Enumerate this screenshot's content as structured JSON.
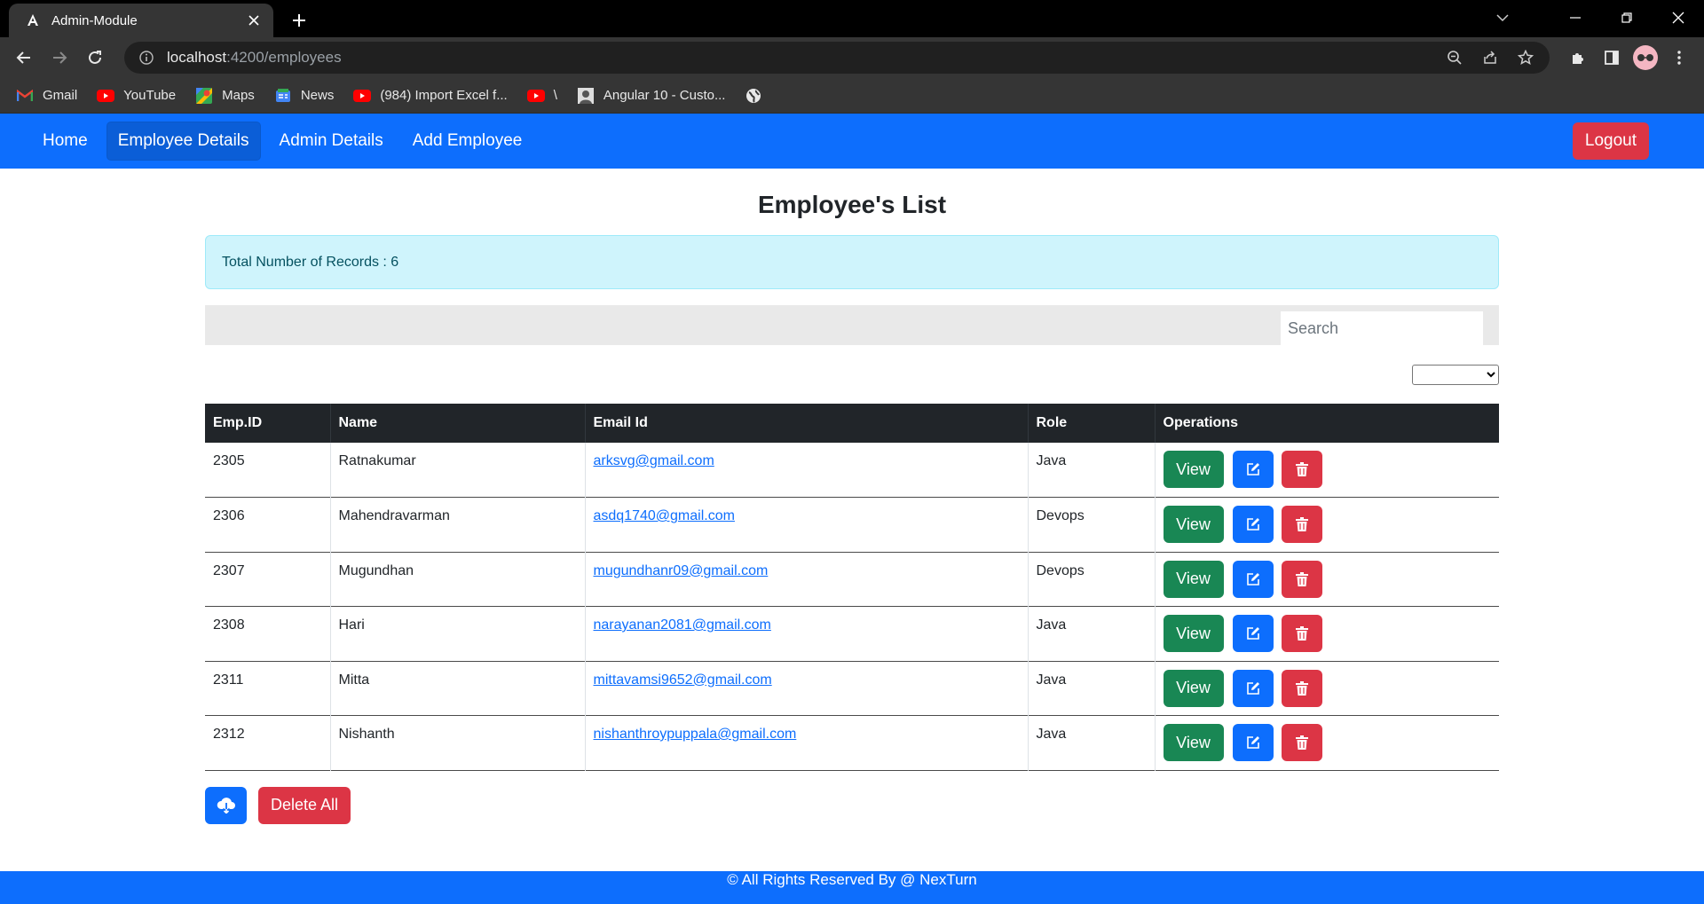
{
  "browser": {
    "tab_title": "Admin-Module",
    "url_host": "localhost",
    "url_path": ":4200/employees",
    "bookmarks": [
      {
        "label": "Gmail",
        "icon": "gmail-icon"
      },
      {
        "label": "YouTube",
        "icon": "youtube-icon"
      },
      {
        "label": "Maps",
        "icon": "maps-icon"
      },
      {
        "label": "News",
        "icon": "news-icon"
      },
      {
        "label": "(984) Import Excel f...",
        "icon": "youtube-icon"
      },
      {
        "label": "\\",
        "icon": "youtube-icon"
      },
      {
        "label": "Angular 10 - Custo...",
        "icon": "page-icon"
      },
      {
        "label": "",
        "icon": "globe-icon"
      }
    ]
  },
  "nav": {
    "items": [
      {
        "label": "Home",
        "active": false
      },
      {
        "label": "Employee Details",
        "active": true
      },
      {
        "label": "Admin Details",
        "active": false
      },
      {
        "label": "Add Employee",
        "active": false
      }
    ],
    "logout_label": "Logout"
  },
  "main": {
    "title": "Employee's List",
    "records_text": "Total Number of Records : 6",
    "search_placeholder": "Search",
    "columns": [
      "Emp.ID",
      "Name",
      "Email Id",
      "Role",
      "Operations"
    ],
    "rows": [
      {
        "id": "2305",
        "name": "Ratnakumar",
        "email": "arksvg@gmail.com",
        "role": "Java"
      },
      {
        "id": "2306",
        "name": "Mahendravarman",
        "email": "asdq1740@gmail.com",
        "role": "Devops"
      },
      {
        "id": "2307",
        "name": "Mugundhan",
        "email": "mugundhanr09@gmail.com",
        "role": "Devops"
      },
      {
        "id": "2308",
        "name": "Hari",
        "email": "narayanan2081@gmail.com",
        "role": "Java"
      },
      {
        "id": "2311",
        "name": "Mitta",
        "email": "mittavamsi9652@gmail.com",
        "role": "Java"
      },
      {
        "id": "2312",
        "name": "Nishanth",
        "email": "nishanthroypuppala@gmail.com",
        "role": "Java"
      }
    ],
    "view_label": "View",
    "delete_all_label": "Delete All"
  },
  "footer": {
    "text": "© All Rights Reserved By @ NexTurn"
  },
  "colors": {
    "primary": "#0d6efd",
    "danger": "#dc3545",
    "success": "#198754",
    "info_bg": "#cff4fc",
    "table_header": "#212529"
  }
}
